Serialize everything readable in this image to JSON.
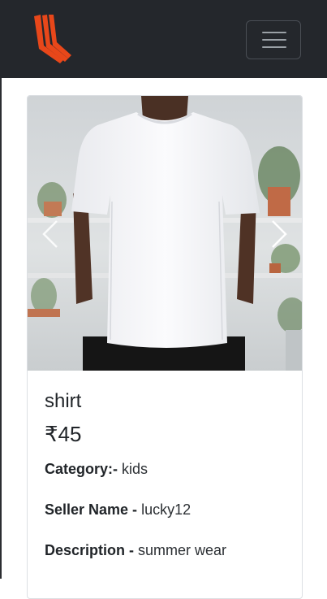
{
  "navbar": {
    "brand_icon": "orange-stripes-logo",
    "menu_icon": "hamburger-icon"
  },
  "product": {
    "image_alt": "white t-shirt",
    "carousel": {
      "prev_icon": "chevron-left-icon",
      "next_icon": "chevron-right-icon"
    },
    "title": "shirt",
    "price": "₹45",
    "category_label": "Category:-",
    "category_value": "kids",
    "seller_label": "Seller Name -",
    "seller_value": "lucky12",
    "description_label": "Description -",
    "description_value": "summer wear"
  },
  "colors": {
    "navbar_bg": "#24272c",
    "brand_orange": "#e8471a"
  }
}
